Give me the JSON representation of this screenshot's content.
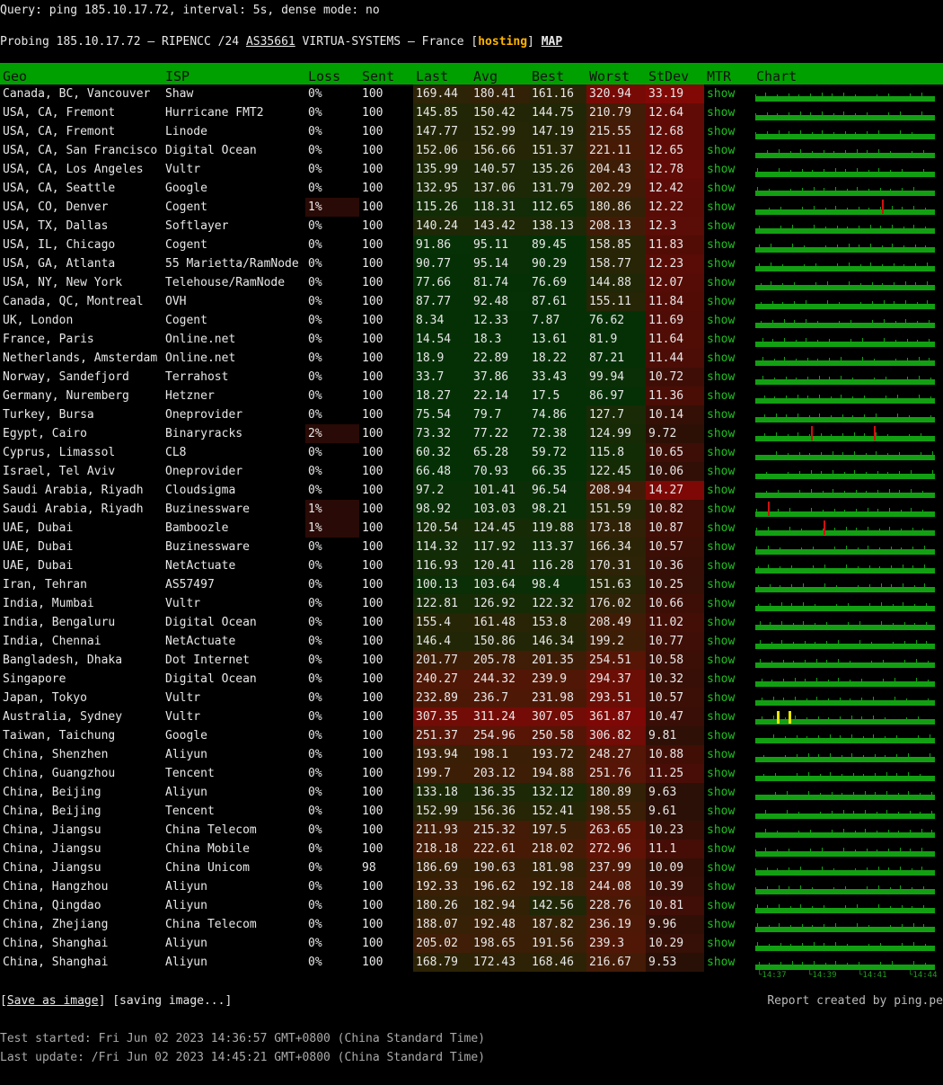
{
  "query": "Query: ping 185.10.17.72, interval: 5s, dense mode: no",
  "probe": {
    "prefix": "Probing 185.10.17.72 – RIPENCC /24 ",
    "asn": "AS35661",
    "mid": " VIRTUA-SYSTEMS – France [",
    "tag": "hosting",
    "close": "] ",
    "map": "MAP"
  },
  "headers": [
    "Geo",
    "ISP",
    "Loss",
    "Sent",
    "Last",
    "Avg",
    "Best",
    "Worst",
    "StDev",
    "MTR",
    "Chart"
  ],
  "mtr_label": "show",
  "rows": [
    {
      "geo": "Canada, BC, Vancouver",
      "isp": "Shaw",
      "loss": "0%",
      "sent": "100",
      "last": "169.44",
      "avg": "180.41",
      "best": "161.16",
      "worst": "320.94",
      "stdev": "33.19"
    },
    {
      "geo": "USA, CA, Fremont",
      "isp": "Hurricane FMT2",
      "loss": "0%",
      "sent": "100",
      "last": "145.85",
      "avg": "150.42",
      "best": "144.75",
      "worst": "210.79",
      "stdev": "12.64"
    },
    {
      "geo": "USA, CA, Fremont",
      "isp": "Linode",
      "loss": "0%",
      "sent": "100",
      "last": "147.77",
      "avg": "152.99",
      "best": "147.19",
      "worst": "215.55",
      "stdev": "12.68"
    },
    {
      "geo": "USA, CA, San Francisco",
      "isp": "Digital Ocean",
      "loss": "0%",
      "sent": "100",
      "last": "152.06",
      "avg": "156.66",
      "best": "151.37",
      "worst": "221.11",
      "stdev": "12.65"
    },
    {
      "geo": "USA, CA, Los Angeles",
      "isp": "Vultr",
      "loss": "0%",
      "sent": "100",
      "last": "135.99",
      "avg": "140.57",
      "best": "135.26",
      "worst": "204.43",
      "stdev": "12.78"
    },
    {
      "geo": "USA, CA, Seattle",
      "isp": "Google",
      "loss": "0%",
      "sent": "100",
      "last": "132.95",
      "avg": "137.06",
      "best": "131.79",
      "worst": "202.29",
      "stdev": "12.42"
    },
    {
      "geo": "USA, CO, Denver",
      "isp": "Cogent",
      "loss": "1%",
      "sent": "100",
      "last": "115.26",
      "avg": "118.31",
      "best": "112.65",
      "worst": "180.86",
      "stdev": "12.22"
    },
    {
      "geo": "USA, TX, Dallas",
      "isp": "Softlayer",
      "loss": "0%",
      "sent": "100",
      "last": "140.24",
      "avg": "143.42",
      "best": "138.13",
      "worst": "208.13",
      "stdev": "12.3"
    },
    {
      "geo": "USA, IL, Chicago",
      "isp": "Cogent",
      "loss": "0%",
      "sent": "100",
      "last": "91.86",
      "avg": "95.11",
      "best": "89.45",
      "worst": "158.85",
      "stdev": "11.83"
    },
    {
      "geo": "USA, GA, Atlanta",
      "isp": "55 Marietta/RamNode",
      "loss": "0%",
      "sent": "100",
      "last": "90.77",
      "avg": "95.14",
      "best": "90.29",
      "worst": "158.77",
      "stdev": "12.23"
    },
    {
      "geo": "USA, NY, New York",
      "isp": "Telehouse/RamNode",
      "loss": "0%",
      "sent": "100",
      "last": "77.66",
      "avg": "81.74",
      "best": "76.69",
      "worst": "144.88",
      "stdev": "12.07"
    },
    {
      "geo": "Canada, QC, Montreal",
      "isp": "OVH",
      "loss": "0%",
      "sent": "100",
      "last": "87.77",
      "avg": "92.48",
      "best": "87.61",
      "worst": "155.11",
      "stdev": "11.84"
    },
    {
      "geo": "UK, London",
      "isp": "Cogent",
      "loss": "0%",
      "sent": "100",
      "last": "8.34",
      "avg": "12.33",
      "best": "7.87",
      "worst": "76.62",
      "stdev": "11.69"
    },
    {
      "geo": "France, Paris",
      "isp": "Online.net",
      "loss": "0%",
      "sent": "100",
      "last": "14.54",
      "avg": "18.3",
      "best": "13.61",
      "worst": "81.9",
      "stdev": "11.64"
    },
    {
      "geo": "Netherlands, Amsterdam",
      "isp": "Online.net",
      "loss": "0%",
      "sent": "100",
      "last": "18.9",
      "avg": "22.89",
      "best": "18.22",
      "worst": "87.21",
      "stdev": "11.44"
    },
    {
      "geo": "Norway, Sandefjord",
      "isp": "Terrahost",
      "loss": "0%",
      "sent": "100",
      "last": "33.7",
      "avg": "37.86",
      "best": "33.43",
      "worst": "99.94",
      "stdev": "10.72"
    },
    {
      "geo": "Germany, Nuremberg",
      "isp": "Hetzner",
      "loss": "0%",
      "sent": "100",
      "last": "18.27",
      "avg": "22.14",
      "best": "17.5",
      "worst": "86.97",
      "stdev": "11.36"
    },
    {
      "geo": "Turkey, Bursa",
      "isp": "Oneprovider",
      "loss": "0%",
      "sent": "100",
      "last": "75.54",
      "avg": "79.7",
      "best": "74.86",
      "worst": "127.7",
      "stdev": "10.14"
    },
    {
      "geo": "Egypt, Cairo",
      "isp": "Binaryracks",
      "loss": "2%",
      "sent": "100",
      "last": "73.32",
      "avg": "77.22",
      "best": "72.38",
      "worst": "124.99",
      "stdev": "9.72"
    },
    {
      "geo": "Cyprus, Limassol",
      "isp": "CL8",
      "loss": "0%",
      "sent": "100",
      "last": "60.32",
      "avg": "65.28",
      "best": "59.72",
      "worst": "115.8",
      "stdev": "10.65"
    },
    {
      "geo": "Israel, Tel Aviv",
      "isp": "Oneprovider",
      "loss": "0%",
      "sent": "100",
      "last": "66.48",
      "avg": "70.93",
      "best": "66.35",
      "worst": "122.45",
      "stdev": "10.06"
    },
    {
      "geo": "Saudi Arabia, Riyadh",
      "isp": "Cloudsigma",
      "loss": "0%",
      "sent": "100",
      "last": "97.2",
      "avg": "101.41",
      "best": "96.54",
      "worst": "208.94",
      "stdev": "14.27"
    },
    {
      "geo": "Saudi Arabia, Riyadh",
      "isp": "Buzinessware",
      "loss": "1%",
      "sent": "100",
      "last": "98.92",
      "avg": "103.03",
      "best": "98.21",
      "worst": "151.59",
      "stdev": "10.82"
    },
    {
      "geo": "UAE, Dubai",
      "isp": "Bamboozle",
      "loss": "1%",
      "sent": "100",
      "last": "120.54",
      "avg": "124.45",
      "best": "119.88",
      "worst": "173.18",
      "stdev": "10.87"
    },
    {
      "geo": "UAE, Dubai",
      "isp": "Buzinessware",
      "loss": "0%",
      "sent": "100",
      "last": "114.32",
      "avg": "117.92",
      "best": "113.37",
      "worst": "166.34",
      "stdev": "10.57"
    },
    {
      "geo": "UAE, Dubai",
      "isp": "NetActuate",
      "loss": "0%",
      "sent": "100",
      "last": "116.93",
      "avg": "120.41",
      "best": "116.28",
      "worst": "170.31",
      "stdev": "10.36"
    },
    {
      "geo": "Iran, Tehran",
      "isp": "AS57497",
      "loss": "0%",
      "sent": "100",
      "last": "100.13",
      "avg": "103.64",
      "best": "98.4",
      "worst": "151.63",
      "stdev": "10.25"
    },
    {
      "geo": "India, Mumbai",
      "isp": "Vultr",
      "loss": "0%",
      "sent": "100",
      "last": "122.81",
      "avg": "126.92",
      "best": "122.32",
      "worst": "176.02",
      "stdev": "10.66"
    },
    {
      "geo": "India, Bengaluru",
      "isp": "Digital Ocean",
      "loss": "0%",
      "sent": "100",
      "last": "155.4",
      "avg": "161.48",
      "best": "153.8",
      "worst": "208.49",
      "stdev": "11.02"
    },
    {
      "geo": "India, Chennai",
      "isp": "NetActuate",
      "loss": "0%",
      "sent": "100",
      "last": "146.4",
      "avg": "150.86",
      "best": "146.34",
      "worst": "199.2",
      "stdev": "10.77"
    },
    {
      "geo": "Bangladesh, Dhaka",
      "isp": "Dot Internet",
      "loss": "0%",
      "sent": "100",
      "last": "201.77",
      "avg": "205.78",
      "best": "201.35",
      "worst": "254.51",
      "stdev": "10.58"
    },
    {
      "geo": "Singapore",
      "isp": "Digital Ocean",
      "loss": "0%",
      "sent": "100",
      "last": "240.27",
      "avg": "244.32",
      "best": "239.9",
      "worst": "294.37",
      "stdev": "10.32"
    },
    {
      "geo": "Japan, Tokyo",
      "isp": "Vultr",
      "loss": "0%",
      "sent": "100",
      "last": "232.89",
      "avg": "236.7",
      "best": "231.98",
      "worst": "293.51",
      "stdev": "10.57"
    },
    {
      "geo": "Australia, Sydney",
      "isp": "Vultr",
      "loss": "0%",
      "sent": "100",
      "last": "307.35",
      "avg": "311.24",
      "best": "307.05",
      "worst": "361.87",
      "stdev": "10.47"
    },
    {
      "geo": "Taiwan, Taichung",
      "isp": "Google",
      "loss": "0%",
      "sent": "100",
      "last": "251.37",
      "avg": "254.96",
      "best": "250.58",
      "worst": "306.82",
      "stdev": "9.81"
    },
    {
      "geo": "China, Shenzhen",
      "isp": "Aliyun",
      "loss": "0%",
      "sent": "100",
      "last": "193.94",
      "avg": "198.1",
      "best": "193.72",
      "worst": "248.27",
      "stdev": "10.88"
    },
    {
      "geo": "China, Guangzhou",
      "isp": "Tencent",
      "loss": "0%",
      "sent": "100",
      "last": "199.7",
      "avg": "203.12",
      "best": "194.88",
      "worst": "251.76",
      "stdev": "11.25"
    },
    {
      "geo": "China, Beijing",
      "isp": "Aliyun",
      "loss": "0%",
      "sent": "100",
      "last": "133.18",
      "avg": "136.35",
      "best": "132.12",
      "worst": "180.89",
      "stdev": "9.63"
    },
    {
      "geo": "China, Beijing",
      "isp": "Tencent",
      "loss": "0%",
      "sent": "100",
      "last": "152.99",
      "avg": "156.36",
      "best": "152.41",
      "worst": "198.55",
      "stdev": "9.61"
    },
    {
      "geo": "China, Jiangsu",
      "isp": "China Telecom",
      "loss": "0%",
      "sent": "100",
      "last": "211.93",
      "avg": "215.32",
      "best": "197.5",
      "worst": "263.65",
      "stdev": "10.23"
    },
    {
      "geo": "China, Jiangsu",
      "isp": "China Mobile",
      "loss": "0%",
      "sent": "100",
      "last": "218.18",
      "avg": "222.61",
      "best": "218.02",
      "worst": "272.96",
      "stdev": "11.1"
    },
    {
      "geo": "China, Jiangsu",
      "isp": "China Unicom",
      "loss": "0%",
      "sent": "98",
      "last": "186.69",
      "avg": "190.63",
      "best": "181.98",
      "worst": "237.99",
      "stdev": "10.09"
    },
    {
      "geo": "China, Hangzhou",
      "isp": "Aliyun",
      "loss": "0%",
      "sent": "100",
      "last": "192.33",
      "avg": "196.62",
      "best": "192.18",
      "worst": "244.08",
      "stdev": "10.39"
    },
    {
      "geo": "China, Qingdao",
      "isp": "Aliyun",
      "loss": "0%",
      "sent": "100",
      "last": "180.26",
      "avg": "182.94",
      "best": "142.56",
      "worst": "228.76",
      "stdev": "10.81"
    },
    {
      "geo": "China, Zhejiang",
      "isp": "China Telecom",
      "loss": "0%",
      "sent": "100",
      "last": "188.07",
      "avg": "192.48",
      "best": "187.82",
      "worst": "236.19",
      "stdev": "9.96"
    },
    {
      "geo": "China, Shanghai",
      "isp": "Aliyun",
      "loss": "0%",
      "sent": "100",
      "last": "205.02",
      "avg": "198.65",
      "best": "191.56",
      "worst": "239.3",
      "stdev": "10.29"
    },
    {
      "geo": "China, Shanghai",
      "isp": "Aliyun",
      "loss": "0%",
      "sent": "100",
      "last": "168.79",
      "avg": "172.43",
      "best": "168.46",
      "worst": "216.67",
      "stdev": "9.53"
    }
  ],
  "time_ticks": [
    "14:37",
    "14:39",
    "14:41",
    "14:44"
  ],
  "footer": {
    "open": "[",
    "save": "Save as image",
    "mid": "] [saving image...]",
    "created": "Report created by ping.pe",
    "started": "Test started: Fri Jun 02 2023 14:36:57 GMT+0800 (China Standard Time)",
    "updated": "Last update: /Fri Jun 02 2023 14:45:21 GMT+0800 (China Standard Time)"
  },
  "colors": {
    "header_bg": "#00a000",
    "chart_green": "#12a012",
    "loss_red": "#d01010",
    "spike_yellow": "#e8e800",
    "hosting": "#ffb400",
    "mtr_link": "#20c020"
  }
}
